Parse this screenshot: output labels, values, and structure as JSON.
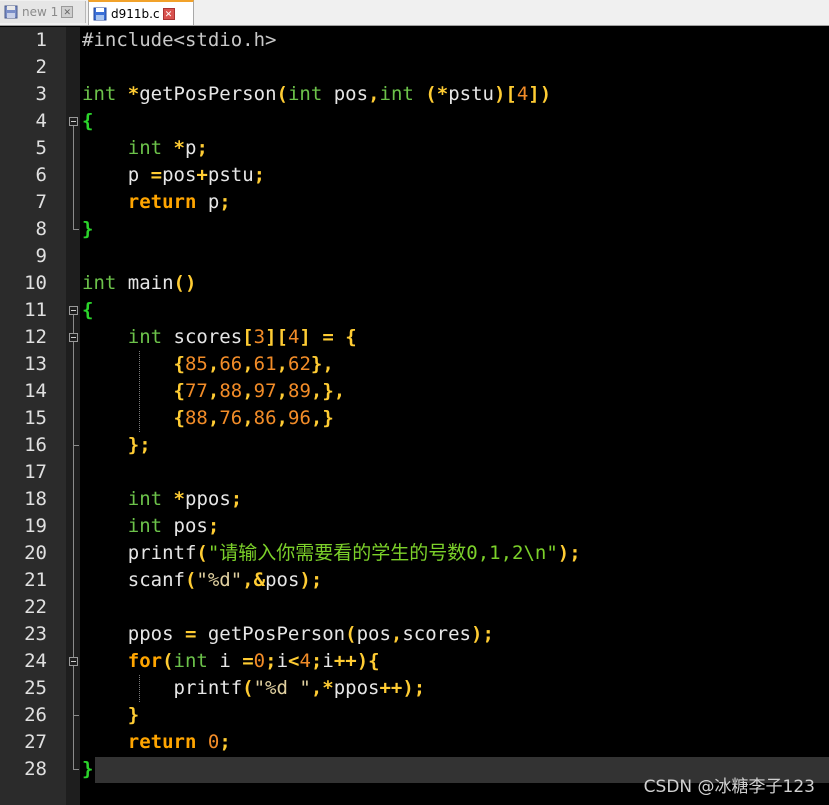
{
  "tabs": [
    {
      "label": "new 1",
      "close": "✕",
      "icon": "save-icon"
    },
    {
      "label": "d911b.c",
      "close": "✕",
      "icon": "save-icon"
    }
  ],
  "lines": [
    [
      [
        "pre",
        "#include<stdio.h>"
      ]
    ],
    [],
    [
      [
        "kw",
        "int"
      ],
      [
        "plain",
        " "
      ],
      [
        "op",
        "*"
      ],
      [
        "plain",
        "getPosPerson"
      ],
      [
        "op",
        "("
      ],
      [
        "kw",
        "int"
      ],
      [
        "plain",
        " pos"
      ],
      [
        "op",
        ","
      ],
      [
        "kw",
        "int"
      ],
      [
        "plain",
        " "
      ],
      [
        "op",
        "(*"
      ],
      [
        "plain",
        "pstu"
      ],
      [
        "op",
        ")["
      ],
      [
        "num",
        "4"
      ],
      [
        "op",
        "])"
      ]
    ],
    [
      [
        "brace",
        "{"
      ]
    ],
    [
      [
        "plain",
        "    "
      ],
      [
        "kw",
        "int"
      ],
      [
        "plain",
        " "
      ],
      [
        "op",
        "*"
      ],
      [
        "plain",
        "p"
      ],
      [
        "op",
        ";"
      ]
    ],
    [
      [
        "plain",
        "    p "
      ],
      [
        "op",
        "="
      ],
      [
        "plain",
        "pos"
      ],
      [
        "op",
        "+"
      ],
      [
        "plain",
        "pstu"
      ],
      [
        "op",
        ";"
      ]
    ],
    [
      [
        "plain",
        "    "
      ],
      [
        "kw2",
        "return"
      ],
      [
        "plain",
        " p"
      ],
      [
        "op",
        ";"
      ]
    ],
    [
      [
        "brace",
        "}"
      ]
    ],
    [],
    [
      [
        "kw",
        "int"
      ],
      [
        "plain",
        " main"
      ],
      [
        "op",
        "()"
      ]
    ],
    [
      [
        "brace",
        "{"
      ]
    ],
    [
      [
        "plain",
        "    "
      ],
      [
        "kw",
        "int"
      ],
      [
        "plain",
        " scores"
      ],
      [
        "op",
        "["
      ],
      [
        "num",
        "3"
      ],
      [
        "op",
        "]["
      ],
      [
        "num",
        "4"
      ],
      [
        "op",
        "]"
      ],
      [
        "plain",
        " "
      ],
      [
        "op",
        "="
      ],
      [
        "plain",
        " "
      ],
      [
        "op",
        "{"
      ]
    ],
    [
      [
        "plain",
        "        "
      ],
      [
        "op",
        "{"
      ],
      [
        "num",
        "85"
      ],
      [
        "op",
        ","
      ],
      [
        "num",
        "66"
      ],
      [
        "op",
        ","
      ],
      [
        "num",
        "61"
      ],
      [
        "op",
        ","
      ],
      [
        "num",
        "62"
      ],
      [
        "op",
        "},"
      ]
    ],
    [
      [
        "plain",
        "        "
      ],
      [
        "op",
        "{"
      ],
      [
        "num",
        "77"
      ],
      [
        "op",
        ","
      ],
      [
        "num",
        "88"
      ],
      [
        "op",
        ","
      ],
      [
        "num",
        "97"
      ],
      [
        "op",
        ","
      ],
      [
        "num",
        "89"
      ],
      [
        "op",
        ",},"
      ]
    ],
    [
      [
        "plain",
        "        "
      ],
      [
        "op",
        "{"
      ],
      [
        "num",
        "88"
      ],
      [
        "op",
        ","
      ],
      [
        "num",
        "76"
      ],
      [
        "op",
        ","
      ],
      [
        "num",
        "86"
      ],
      [
        "op",
        ","
      ],
      [
        "num",
        "96"
      ],
      [
        "op",
        ",}"
      ]
    ],
    [
      [
        "plain",
        "    "
      ],
      [
        "op",
        "};"
      ]
    ],
    [],
    [
      [
        "plain",
        "    "
      ],
      [
        "kw",
        "int"
      ],
      [
        "plain",
        " "
      ],
      [
        "op",
        "*"
      ],
      [
        "plain",
        "ppos"
      ],
      [
        "op",
        ";"
      ]
    ],
    [
      [
        "plain",
        "    "
      ],
      [
        "kw",
        "int"
      ],
      [
        "plain",
        " pos"
      ],
      [
        "op",
        ";"
      ]
    ],
    [
      [
        "plain",
        "    printf"
      ],
      [
        "op",
        "("
      ],
      [
        "strcn",
        "\"请输入你需要看的学生的号数0,1,2\\n\""
      ],
      [
        "op",
        ");"
      ]
    ],
    [
      [
        "plain",
        "    scanf"
      ],
      [
        "op",
        "("
      ],
      [
        "str",
        "\"%d\""
      ],
      [
        "op",
        ",&"
      ],
      [
        "plain",
        "pos"
      ],
      [
        "op",
        ");"
      ]
    ],
    [],
    [
      [
        "plain",
        "    ppos "
      ],
      [
        "op",
        "="
      ],
      [
        "plain",
        " getPosPerson"
      ],
      [
        "op",
        "("
      ],
      [
        "plain",
        "pos"
      ],
      [
        "op",
        ","
      ],
      [
        "plain",
        "scores"
      ],
      [
        "op",
        ");"
      ]
    ],
    [
      [
        "plain",
        "    "
      ],
      [
        "kw2",
        "for"
      ],
      [
        "op",
        "("
      ],
      [
        "kw",
        "int"
      ],
      [
        "plain",
        " i "
      ],
      [
        "op",
        "="
      ],
      [
        "num",
        "0"
      ],
      [
        "op",
        ";"
      ],
      [
        "plain",
        "i"
      ],
      [
        "op",
        "<"
      ],
      [
        "num",
        "4"
      ],
      [
        "op",
        ";"
      ],
      [
        "plain",
        "i"
      ],
      [
        "op",
        "++){"
      ]
    ],
    [
      [
        "plain",
        "        printf"
      ],
      [
        "op",
        "("
      ],
      [
        "str",
        "\"%d \""
      ],
      [
        "op",
        ",*"
      ],
      [
        "plain",
        "ppos"
      ],
      [
        "op",
        "++);"
      ]
    ],
    [
      [
        "plain",
        "    "
      ],
      [
        "op",
        "}"
      ]
    ],
    [
      [
        "plain",
        "    "
      ],
      [
        "kw2",
        "return"
      ],
      [
        "plain",
        " "
      ],
      [
        "num",
        "0"
      ],
      [
        "op",
        ";"
      ]
    ],
    [
      [
        "brace",
        "}"
      ]
    ]
  ],
  "watermark": "CSDN @冰糖李子123",
  "colors": {
    "background": "#000000",
    "gutter": "#2b2b2b",
    "keyword": "#6cc24a",
    "keyword_bold": "#ffa500",
    "operator": "#ffcc33",
    "number": "#f28c28",
    "brace": "#2bd42b",
    "active_tab_accent": "#f2a22a"
  }
}
